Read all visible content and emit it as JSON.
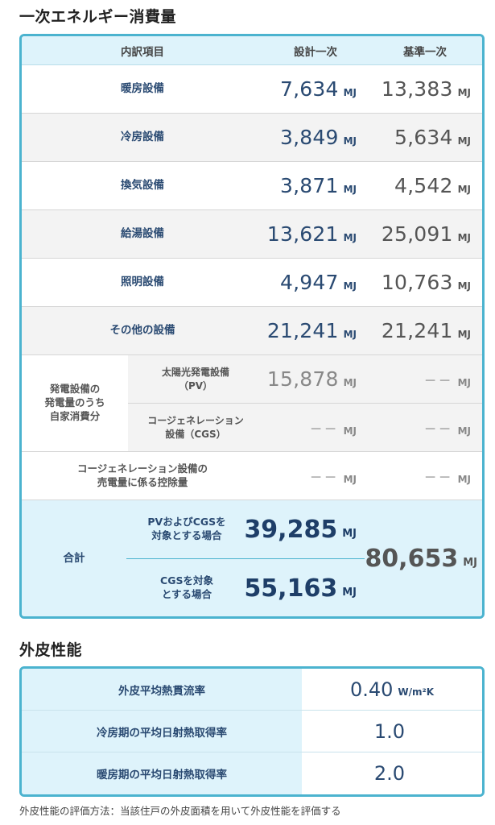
{
  "energy": {
    "title": "一次エネルギー消費量",
    "header": {
      "item": "内訳項目",
      "design": "設計一次",
      "standard": "基準一次"
    },
    "unit": "MJ",
    "rows": [
      {
        "label": "暖房設備",
        "design": "7,634",
        "standard": "13,383"
      },
      {
        "label": "冷房設備",
        "design": "3,849",
        "standard": "5,634"
      },
      {
        "label": "換気設備",
        "design": "3,871",
        "standard": "4,542"
      },
      {
        "label": "給湯設備",
        "design": "13,621",
        "standard": "25,091"
      },
      {
        "label": "照明設備",
        "design": "4,947",
        "standard": "10,763"
      },
      {
        "label": "その他の設備",
        "design": "21,241",
        "standard": "21,241"
      }
    ],
    "generation": {
      "group_label": "発電設備の\n発電量のうち\n自家消費分",
      "pv": {
        "label": "太陽光発電設備\n（PV）",
        "design": "15,878",
        "standard": "－－"
      },
      "cgs": {
        "label": "コージェネレーション\n設備（CGS）",
        "design": "－－",
        "standard": "－－"
      }
    },
    "cgs_deduction": {
      "label": "コージェネレーション設備の\n売電量に係る控除量",
      "design": "－－",
      "standard": "－－"
    },
    "total": {
      "label": "合計",
      "case1_label": "PVおよびCGSを\n対象とする場合",
      "case1_value": "39,285",
      "case2_label": "CGSを対象\nとする場合",
      "case2_value": "55,163",
      "standard_value": "80,653"
    }
  },
  "envelope": {
    "title": "外皮性能",
    "rows": [
      {
        "label": "外皮平均熱貫流率",
        "value": "0.40",
        "unit": "W/m²K"
      },
      {
        "label": "冷房期の平均日射熱取得率",
        "value": "1.0",
        "unit": ""
      },
      {
        "label": "暖房期の平均日射熱取得率",
        "value": "2.0",
        "unit": ""
      }
    ],
    "note": "外皮性能の評価方法：当該住戸の外皮面積を用いて外皮性能を評価する"
  }
}
